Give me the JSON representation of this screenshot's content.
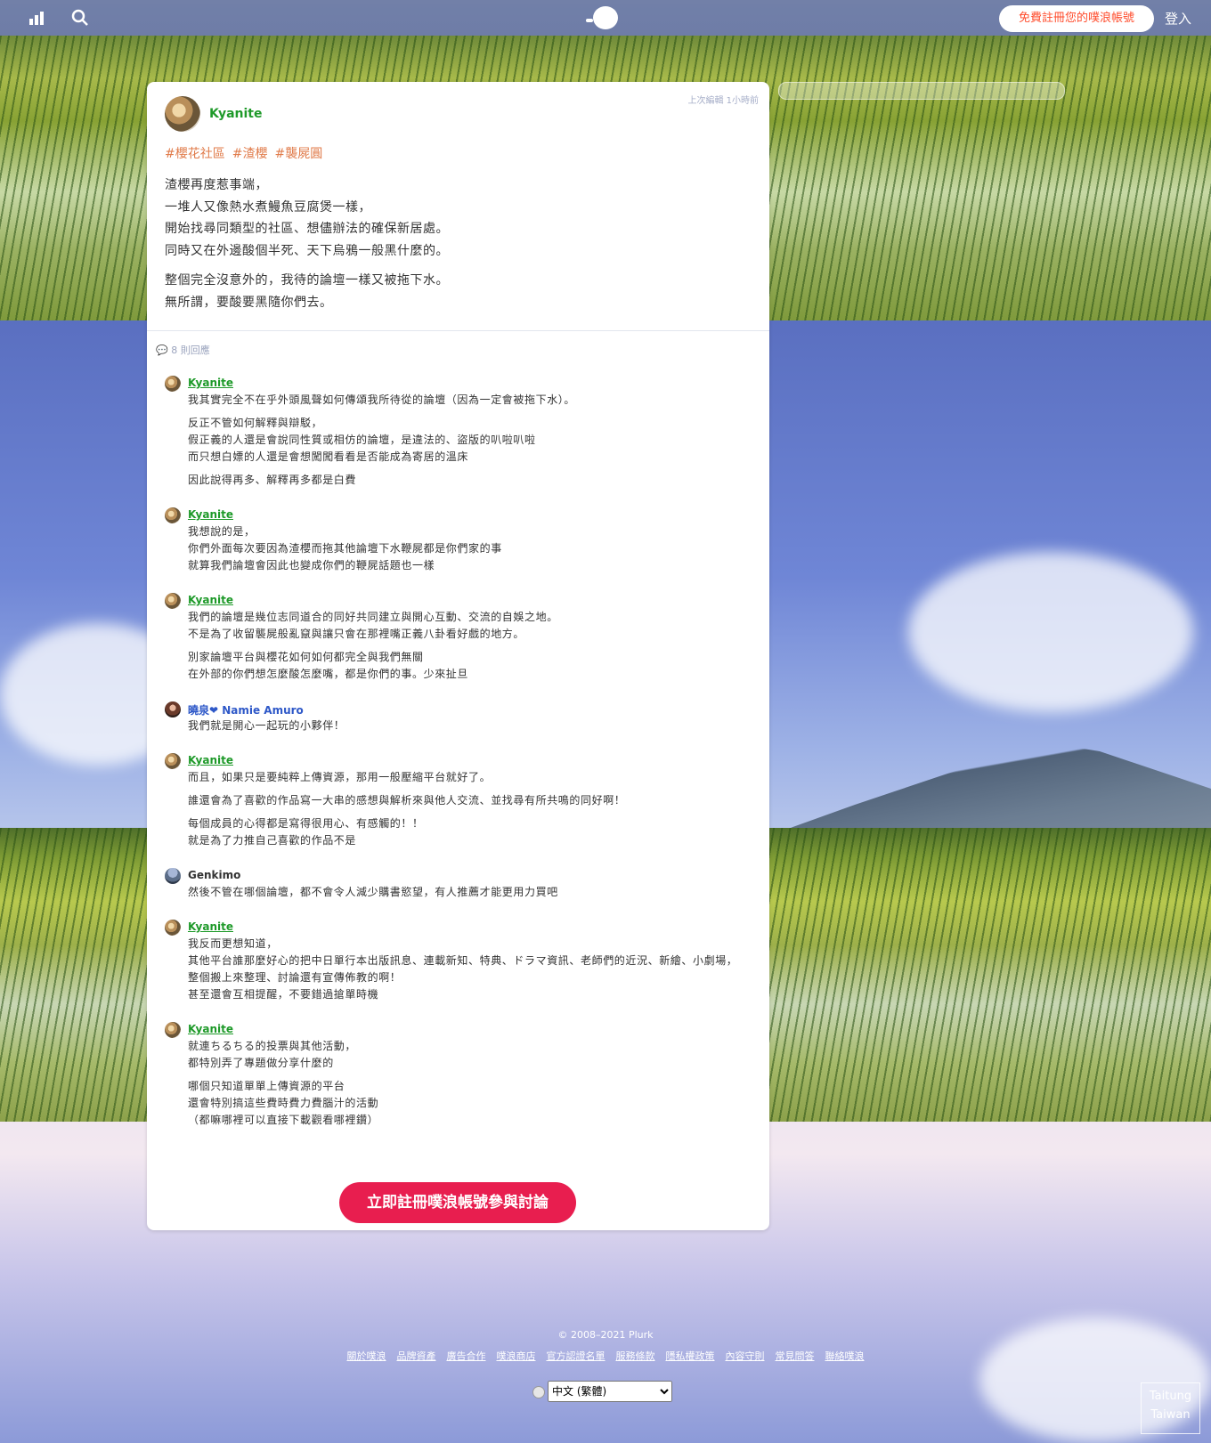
{
  "topbar": {
    "icons": [
      "stats-icon",
      "search-icon",
      "plurk-logo-icon"
    ],
    "register_label": "免費註冊您的噗浪帳號",
    "login_label": "登入"
  },
  "post": {
    "author": "Kyanite",
    "last_edited": "上次編輯 1小時前",
    "tags": [
      "#櫻花社區",
      "#渣櫻",
      "#襲屍圓"
    ],
    "paragraphs": [
      "渣櫻再度惹事端，",
      "一堆人又像熱水煮鰻魚豆腐煲一樣，",
      "開始找尋同類型的社區、想儘辦法的確保新居處。",
      "同時又在外邊酸個半死、天下烏鴉一般黑什麼的。",
      "整個完全沒意外的，我待的論壇一樣又被拖下水。",
      "無所謂，要酸要黑隨你們去。"
    ],
    "reply_count": "8 則回應"
  },
  "replies": [
    {
      "name": "Kyanite",
      "lines": [
        "我其實完全不在乎外頭風聲如何傳頌我所待從的論壇（因為一定會被拖下水）。",
        "反正不管如何解釋與辯駁，",
        "假正義的人還是會說同性質或相仿的論壇，是違法的、盜版的叭啦叭啦",
        "而只想白嫖的人還是會想闖闖看看是否能成為寄居的溫床",
        "因此說得再多、解釋再多都是白費"
      ]
    },
    {
      "name": "Kyanite",
      "lines": [
        "我想說的是，",
        "你們外面每次要因為渣櫻而拖其他論壇下水鞭屍都是你們家的事",
        "就算我們論壇會因此也變成你們的鞭屍話題也一樣"
      ]
    },
    {
      "name": "Kyanite",
      "lines": [
        "我們的論壇是幾位志同道合的同好共同建立與開心互動、交流的自娛之地。",
        "不是為了收留襲屍般亂竄與讓只會在那裡嘴正義八卦看好戲的地方。",
        "別家論壇平台與櫻花如何如何都完全與我們無關",
        "在外部的你們想怎麼酸怎麼嘴，都是你們的事。少來扯旦"
      ]
    },
    {
      "name": "曉泉❤ Namie Amuro",
      "lines": [
        "我們就是開心一起玩的小夥伴！"
      ]
    },
    {
      "name": "Kyanite",
      "lines": [
        "而且，如果只是要純粹上傳資源，那用一般壓縮平台就好了。",
        "誰還會為了喜歡的作品寫一大串的感想與解析來與他人交流、並找尋有所共鳴的同好啊！",
        "每個成員的心得都是寫得很用心、有感觸的！！",
        "就是為了力推自己喜歡的作品不是"
      ]
    },
    {
      "name": "Genkimo",
      "lines": [
        "然後不管在哪個論壇，都不會令人減少購書慾望，有人推薦才能更用力買吧"
      ]
    },
    {
      "name": "Kyanite",
      "lines": [
        "我反而更想知道，",
        "其他平台誰那麼好心的把中日單行本出版訊息、連載新知、特典、ドラマ資訊、老師們的近況、新繪、小劇場，整個搬上來整理、討論還有宣傳佈教的啊！",
        "甚至還會互相提醒，不要錯過搶單時機"
      ]
    },
    {
      "name": "Kyanite",
      "lines": [
        "就連ちるちる的投票與其他活動，",
        "都特別弄了專題做分享什麼的",
        "哪個只知道單單上傳資源的平台",
        "還會特別搞這些費時費力費腦汁的活動",
        "（都嘛哪裡可以直接下載觀看哪裡鑽）"
      ]
    }
  ],
  "cta_label": "立即註冊噗浪帳號參與討論",
  "footer": {
    "copyright": "© 2008–2021 Plurk",
    "links": [
      "關於噗浪",
      "品牌資產",
      "廣告合作",
      "噗浪商店",
      "官方認證名單",
      "服務條款",
      "隱私權政策",
      "內容守則",
      "常見問答",
      "聯絡噗浪"
    ],
    "language": "中文 (繁體)",
    "badge_line1": "Taitung",
    "badge_line2": "Taiwan"
  },
  "colors": {
    "accent_green": "#1f9a2a",
    "cta_red": "#e81e4f",
    "tag_orange": "#e07b4a"
  }
}
